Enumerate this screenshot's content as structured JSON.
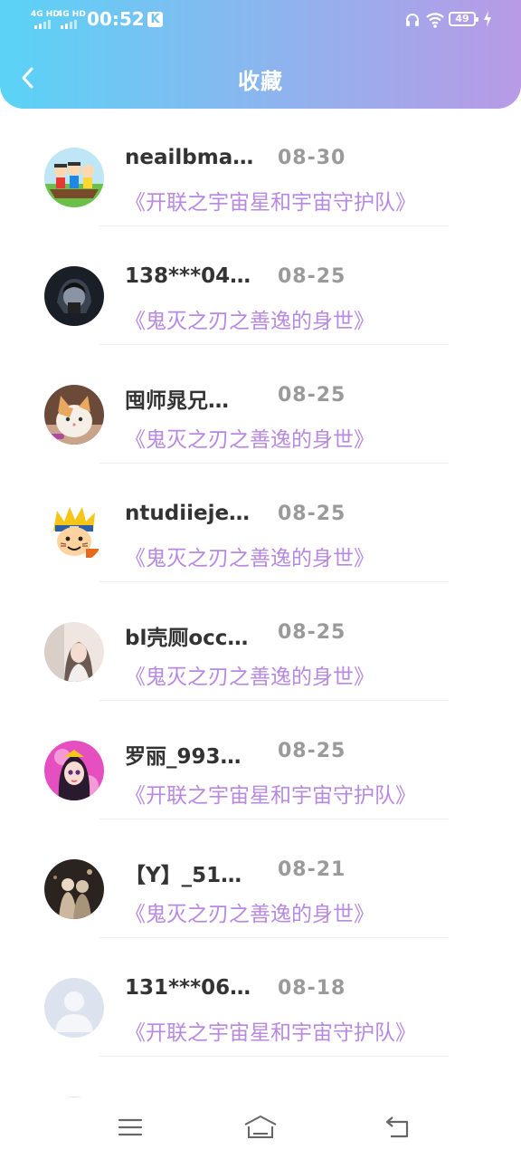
{
  "status_bar": {
    "sim1": "4G HD",
    "sim2": "4G HD",
    "time": "00:52",
    "notification_badge": "K",
    "battery": "49"
  },
  "header": {
    "title": "收藏",
    "back_icon": "chevron-left-icon",
    "gradient_start": "#5ad3f6",
    "gradient_end": "#b99ae6"
  },
  "favorites": [
    {
      "username": "neailbma…",
      "date": "08-30",
      "title": "《开联之宇宙星和宇宙守护队》",
      "avatar": "cartoon-kids-avatar"
    },
    {
      "username": "138***04…",
      "date": "08-25",
      "title": "《鬼灭之刃之善逸的身世》",
      "avatar": "dark-anime-avatar"
    },
    {
      "username": "囤师晁兄…",
      "date": "08-25",
      "title": "《鬼灭之刃之善逸的身世》",
      "avatar": "cat-avatar"
    },
    {
      "username": "ntudiieje…",
      "date": "08-25",
      "title": "《鬼灭之刃之善逸的身世》",
      "avatar": "naruto-avatar"
    },
    {
      "username": "bl壳厕occ…",
      "date": "08-25",
      "title": "《鬼灭之刃之善逸的身世》",
      "avatar": "girl-photo-avatar"
    },
    {
      "username": "罗丽_993…",
      "date": "08-25",
      "title": "《开联之宇宙星和宇宙守护队》",
      "avatar": "doll-avatar"
    },
    {
      "username": "【Y】_51…",
      "date": "08-21",
      "title": "《鬼灭之刃之善逸的身世》",
      "avatar": "couple-photo-avatar"
    },
    {
      "username": "131***06…",
      "date": "08-18",
      "title": "《开联之宇宙星和宇宙守护队》",
      "avatar": "default-user-avatar"
    }
  ],
  "colors": {
    "title_link": "#b889e0",
    "username": "#333333",
    "date": "#9a9a9a"
  },
  "bottom_nav": {
    "menu_icon": "menu-icon",
    "home_icon": "home-icon",
    "back_icon": "return-icon"
  }
}
